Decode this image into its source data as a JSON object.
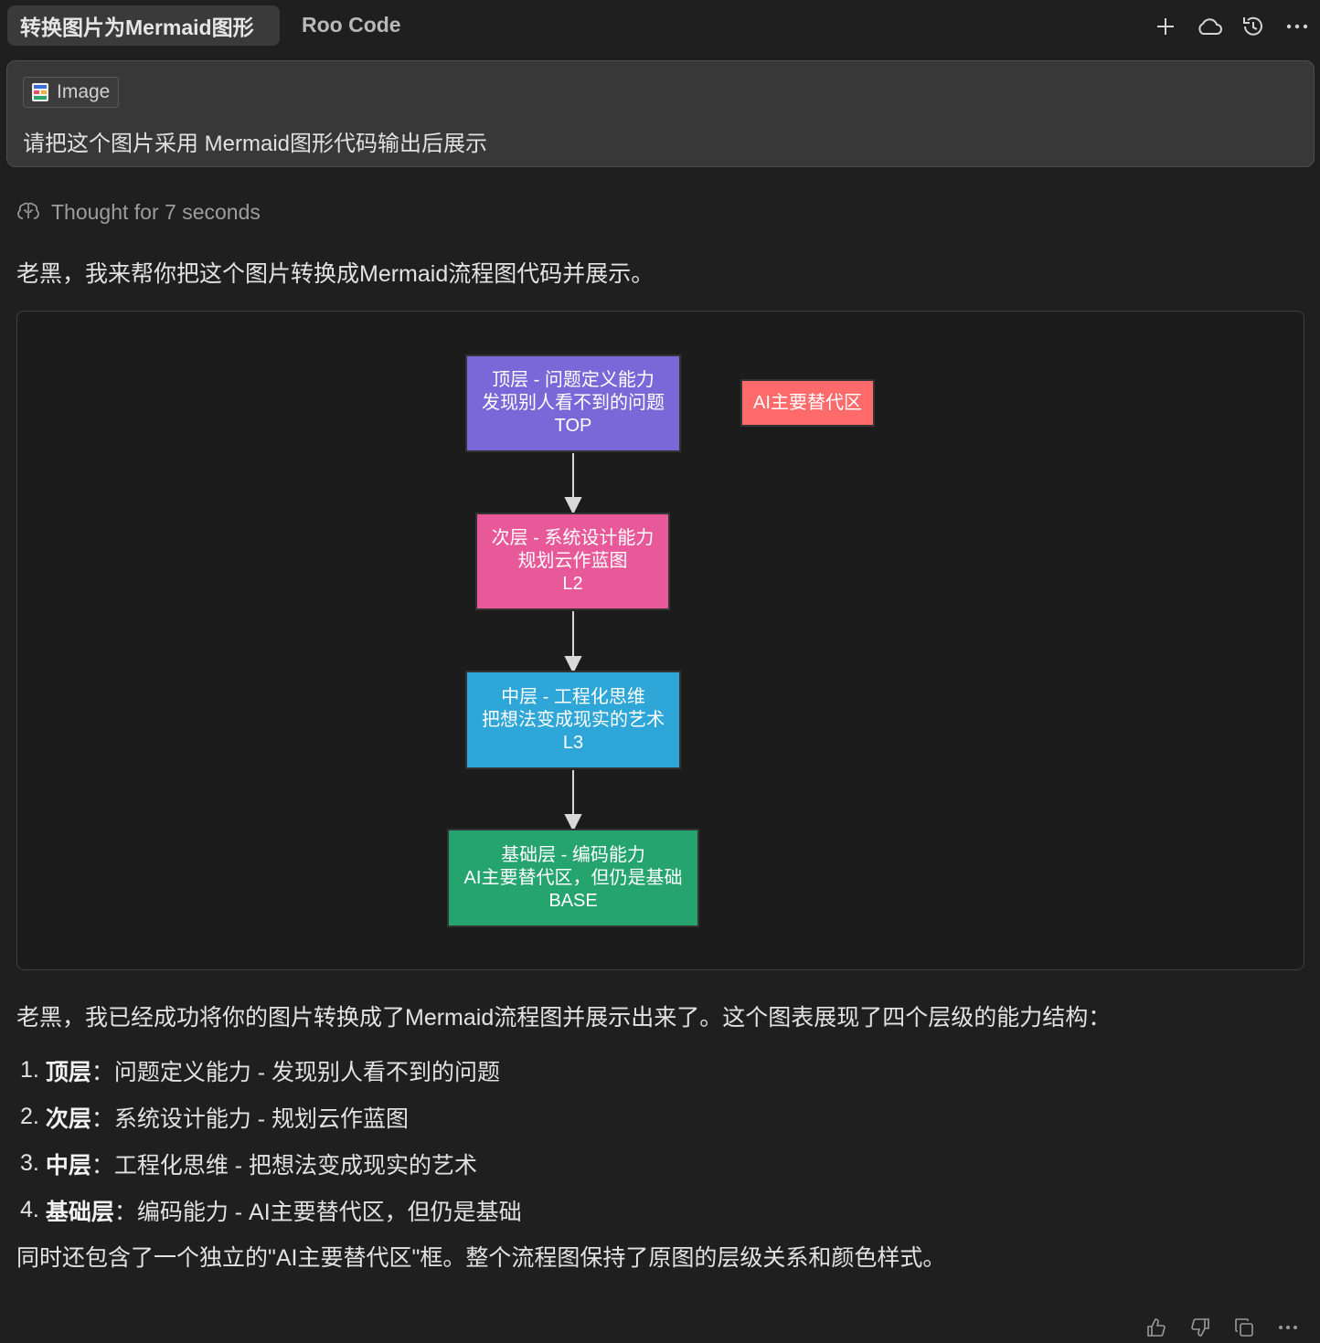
{
  "tabs": {
    "active_label": "转换图片为Mermaid图形",
    "app_label": "Roo Code"
  },
  "icons": {
    "new_task": "plus-icon",
    "cloud": "cloud-icon",
    "history": "history-icon",
    "more": "more-icon",
    "thinking": "brain-icon",
    "image_chip": "image-file-icon",
    "thumbs_up": "thumbs-up-icon",
    "thumbs_down": "thumbs-down-icon",
    "copy": "copy-icon"
  },
  "user_message": {
    "attachment_label": "Image",
    "text": "请把这个图片采用 Mermaid图形代码输出后展示"
  },
  "thought": {
    "label": "Thought for 7 seconds"
  },
  "reply": {
    "intro": "老黑，我来帮你把这个图片转换成Mermaid流程图代码并展示。",
    "summary": "老黑，我已经成功将你的图片转换成了Mermaid流程图并展示出来了。这个图表展现了四个层级的能力结构：",
    "items": [
      {
        "num": "1.",
        "bold": "顶层",
        "rest": "：问题定义能力 - 发现别人看不到的问题"
      },
      {
        "num": "2.",
        "bold": "次层",
        "rest": "：系统设计能力 - 规划云作蓝图"
      },
      {
        "num": "3.",
        "bold": "中层",
        "rest": "：工程化思维 - 把想法变成现实的艺术"
      },
      {
        "num": "4.",
        "bold": "基础层",
        "rest": "：编码能力 - AI主要替代区，但仍是基础"
      }
    ],
    "footer": "同时还包含了一个独立的\"AI主要替代区\"框。整个流程图保持了原图的层级关系和颜色样式。"
  },
  "diagram": {
    "nodes": [
      {
        "id": "top",
        "lines": [
          "顶层 - 问题定义能力",
          "发现别人看不到的问题",
          "TOP"
        ],
        "color": "#7b68d8"
      },
      {
        "id": "l2",
        "lines": [
          "次层 - 系统设计能力",
          "规划云作蓝图",
          "L2"
        ],
        "color": "#e8599a"
      },
      {
        "id": "l3",
        "lines": [
          "中层 - 工程化思维",
          "把想法变成现实的艺术",
          "L3"
        ],
        "color": "#2ea6d8"
      },
      {
        "id": "base",
        "lines": [
          "基础层 - 编码能力",
          "AI主要替代区，但仍是基础",
          "BASE"
        ],
        "color": "#25a46e"
      },
      {
        "id": "ai",
        "lines": [
          "AI主要替代区"
        ],
        "color": "#ff6b6b"
      }
    ],
    "edges": [
      [
        "top",
        "l2"
      ],
      [
        "l2",
        "l3"
      ],
      [
        "l3",
        "base"
      ]
    ]
  }
}
